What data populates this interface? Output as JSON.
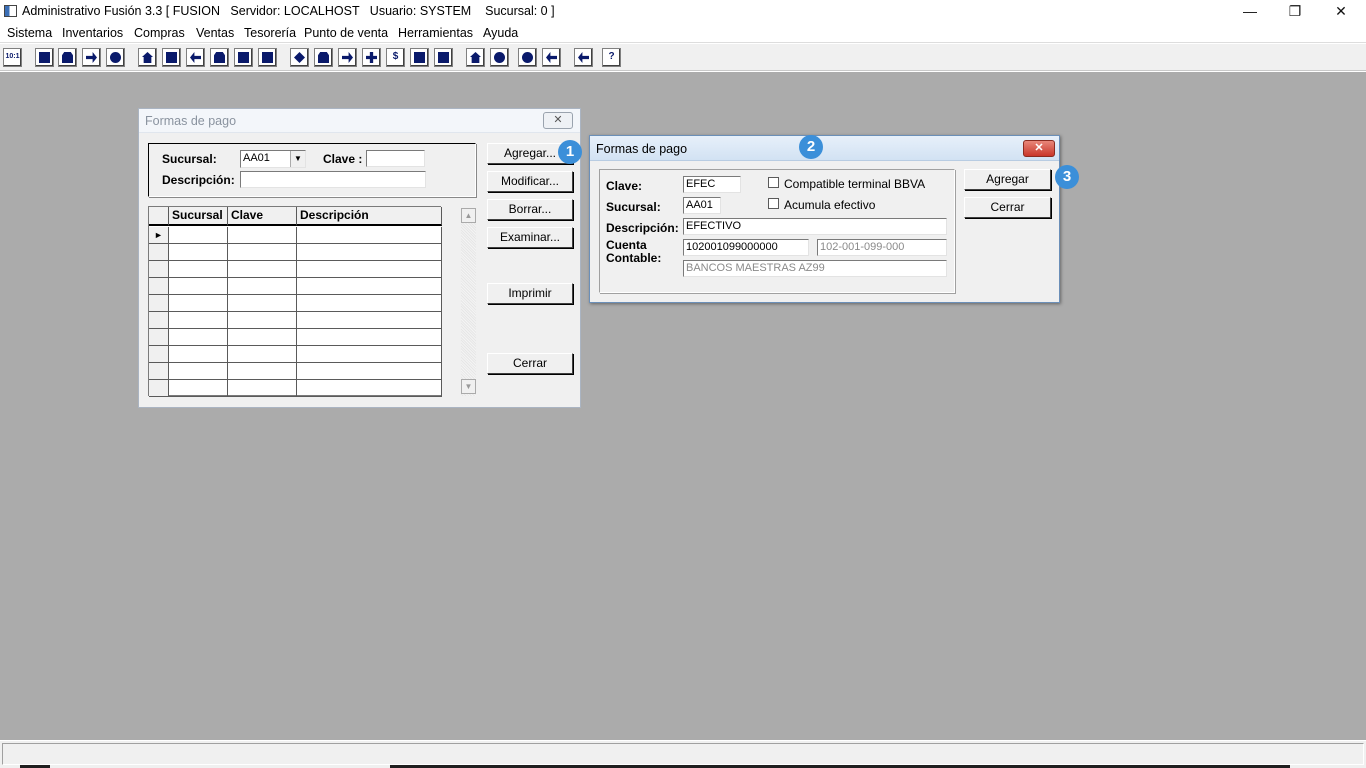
{
  "app": {
    "title": "Administrativo Fusión 3.3 [ FUSION   Servidor: LOCALHOST   Usuario: SYSTEM    Sucursal: 0 ]",
    "window_controls": {
      "minimize": "—",
      "restore": "❐",
      "close": "✕"
    }
  },
  "menu": [
    "Sistema",
    "Inventarios",
    "Compras",
    "Ventas",
    "Tesorería",
    "Punto de venta",
    "Herramientas",
    "Ayuda"
  ],
  "toolbar": {
    "buttons": [
      {
        "name": "calc-icon",
        "glyph": "10:1"
      },
      {
        "name": "copy-icon"
      },
      {
        "name": "clipboard-icon"
      },
      {
        "name": "transfer-icon"
      },
      {
        "name": "zoom-icon"
      },
      {
        "name": "user-icon"
      },
      {
        "name": "folder-icon"
      },
      {
        "name": "print-left-icon"
      },
      {
        "name": "printer-icon"
      },
      {
        "name": "document-icon"
      },
      {
        "name": "list-icon"
      },
      {
        "name": "users-icon"
      },
      {
        "name": "box-icon"
      },
      {
        "name": "export-icon"
      },
      {
        "name": "add-icon"
      },
      {
        "name": "money-icon",
        "glyph": "$"
      },
      {
        "name": "page-icon"
      },
      {
        "name": "table-icon"
      },
      {
        "name": "home-icon"
      },
      {
        "name": "search-icon"
      },
      {
        "name": "refresh-icon"
      },
      {
        "name": "undo-icon"
      },
      {
        "name": "back-icon"
      },
      {
        "name": "help-icon",
        "glyph": "?"
      }
    ]
  },
  "browse_window": {
    "title": "Formas de pago",
    "close_glyph": "✕",
    "sucursal_label": "Sucursal:",
    "sucursal_value": "AA01",
    "clave_label": "Clave :",
    "clave_value": "",
    "descripcion_label": "Descripción:",
    "descripcion_value": "",
    "columns": [
      "Sucursal",
      "Clave",
      "Descripción"
    ],
    "row_pointer": "►",
    "buttons": {
      "agregar": "Agregar...",
      "modificar": "Modificar...",
      "borrar": "Borrar...",
      "examinar": "Examinar...",
      "imprimir": "Imprimir",
      "cerrar": "Cerrar"
    },
    "scroll_up": "▲",
    "scroll_down": "▼"
  },
  "edit_window": {
    "title": "Formas de pago",
    "close_glyph": "✕",
    "clave_label": "Clave:",
    "clave_value": "EFEC",
    "sucursal_label": "Sucursal:",
    "sucursal_value": "AA01",
    "descripcion_label": "Descripción:",
    "descripcion_value": "EFECTIVO",
    "cuenta_label": "Cuenta Contable:",
    "cuenta_value": "102001099000000",
    "cuenta_formatted": "102-001-099-000",
    "cuenta_name": "BANCOS MAESTRAS AZ99",
    "check_bbva_label": "Compatible terminal BBVA",
    "check_efectivo_label": "Acumula efectivo",
    "buttons": {
      "agregar": "Agregar",
      "cerrar": "Cerrar"
    }
  },
  "markers": [
    "1",
    "2",
    "3"
  ],
  "colors": {
    "workspace": "#ababab",
    "marker": "#3b8fd9",
    "close_button": "#d23f31",
    "active_title": "#dbe8f6"
  }
}
